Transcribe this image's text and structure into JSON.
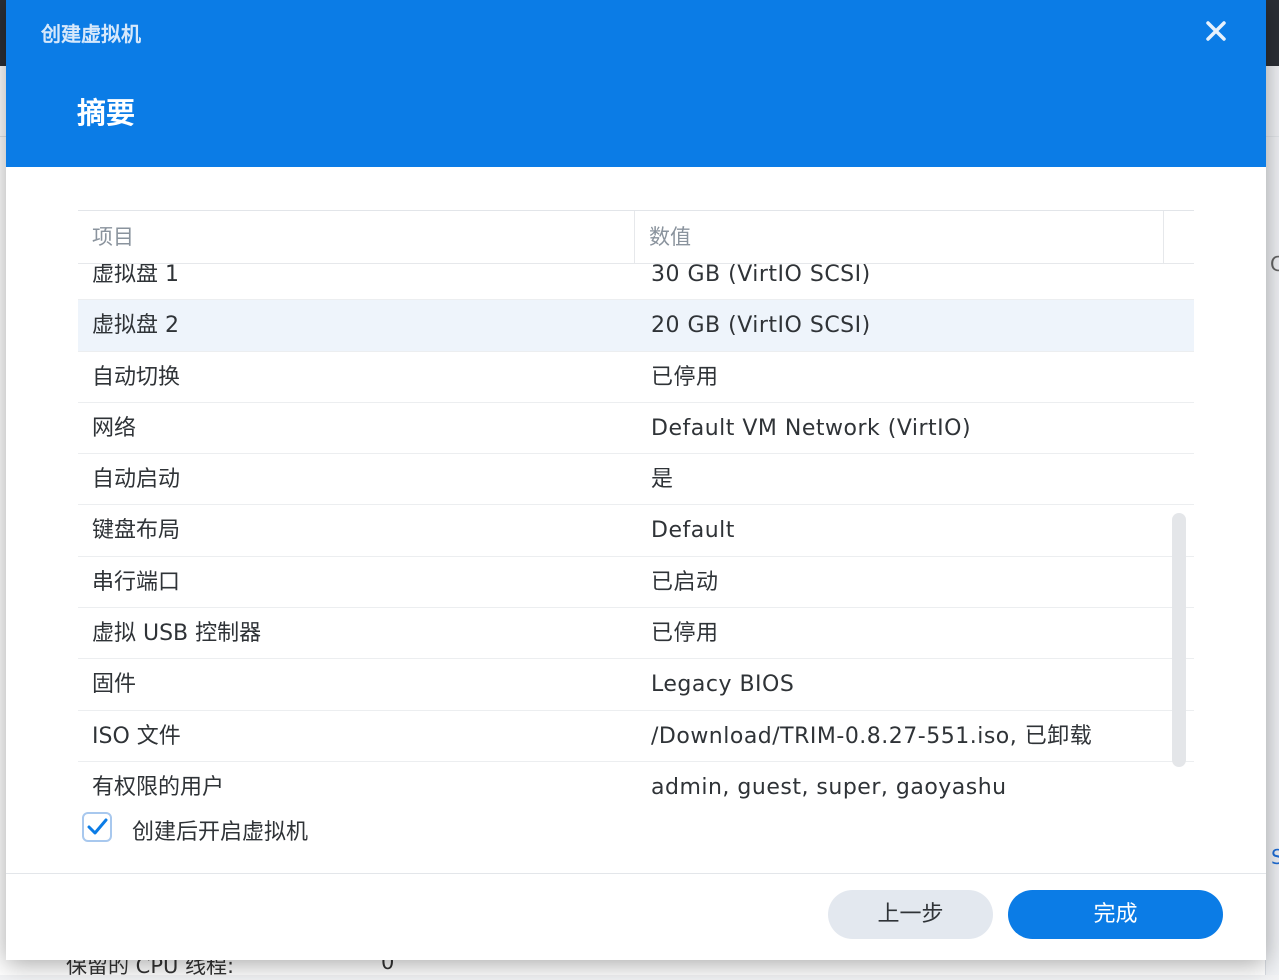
{
  "window": {
    "title": "创建虚拟机",
    "close_icon": "×"
  },
  "step": {
    "title": "摘要"
  },
  "table": {
    "headers": [
      "项目",
      "数值"
    ],
    "rows": [
      {
        "key": "虚拟盘 1",
        "value": "30 GB (VirtIO SCSI)"
      },
      {
        "key": "虚拟盘 2",
        "value": "20 GB (VirtIO SCSI)"
      },
      {
        "key": "自动切换",
        "value": "已停用"
      },
      {
        "key": "网络",
        "value": "Default VM Network (VirtIO)"
      },
      {
        "key": "自动启动",
        "value": "是"
      },
      {
        "key": "键盘布局",
        "value": "Default"
      },
      {
        "key": "串行端口",
        "value": "已启动"
      },
      {
        "key": "虚拟 USB 控制器",
        "value": "已停用"
      },
      {
        "key": "固件",
        "value": "Legacy BIOS"
      },
      {
        "key": "ISO 文件",
        "value": "/Download/TRIM-0.8.27-551.iso, 已卸载"
      },
      {
        "key": "有权限的用户",
        "value": "admin, guest, super, gaoyashu"
      }
    ]
  },
  "options": {
    "start_after_create_label": "创建后开启虚拟机",
    "start_after_create_checked": true
  },
  "footer": {
    "back_label": "上一步",
    "finish_label": "完成"
  },
  "background": {
    "row_label": "保留的 CPU 线程:",
    "row_value": "0",
    "frag_1": "C",
    "frag_2": "S"
  },
  "colors": {
    "accent": "#0b7ce6",
    "checkmark": "#0b7ce6"
  }
}
